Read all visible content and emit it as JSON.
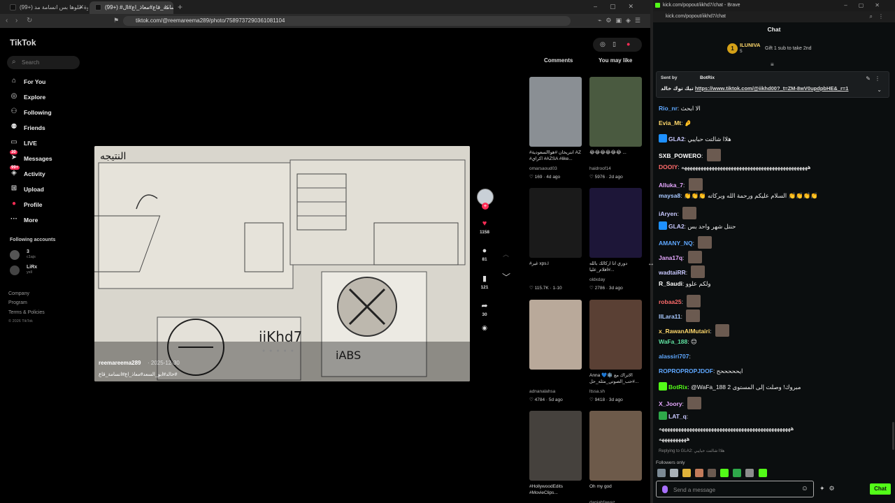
{
  "left_window": {
    "tabs": [
      {
        "label": "(99+) يالله انها حلوة حلوها بس انسامة مد...",
        "active": false
      },
      {
        "label": "(99+) #انسامة_قاع#معاذ_اع#ال...",
        "active": true
      }
    ],
    "url": "tiktok.com/@reemareema289/photo/7589737290361081104"
  },
  "tiktok": {
    "logo": "TikTok",
    "search_placeholder": "Search",
    "nav": [
      {
        "label": "For You",
        "icon": "home-icon"
      },
      {
        "label": "Explore",
        "icon": "compass-icon"
      },
      {
        "label": "Following",
        "icon": "following-icon"
      },
      {
        "label": "Friends",
        "icon": "friends-icon"
      },
      {
        "label": "LIVE",
        "icon": "live-icon"
      },
      {
        "label": "Messages",
        "icon": "messages-icon",
        "badge": "30"
      },
      {
        "label": "Activity",
        "icon": "activity-icon",
        "badge": "99+"
      },
      {
        "label": "Upload",
        "icon": "upload-icon"
      },
      {
        "label": "Profile",
        "icon": "profile-icon"
      },
      {
        "label": "More",
        "icon": "more-icon"
      }
    ],
    "following_title": "Following accounts",
    "accounts": [
      {
        "name": "3",
        "sub": "c1ajs"
      },
      {
        "name": "LiRx",
        "sub": "yxll"
      }
    ],
    "footer": [
      "Company",
      "Program",
      "Terms & Policies"
    ],
    "copyright": "© 2026 TikTok",
    "post": {
      "title": "النتيجه",
      "username": "reemareema289",
      "date": "· 2025-12-30",
      "tags": "خالد#ابو_السعد#معاذ_اع#انسامة_قاع#"
    },
    "actions": {
      "likes": "1158",
      "comments": "81",
      "saves": "121",
      "shares": "30"
    },
    "side_tabs": {
      "comments": "Comments",
      "you_may_like": "You may like"
    },
    "grid": [
      {
        "caption": "#انتريخان #هواالسعودية AZ #اكراي #AZSA #like...",
        "user": "omarsaoud03",
        "likes": "169",
        "age": "4d ago",
        "color": "#8a8f94"
      },
      {
        "caption": "😂😂😂😂😂😂 ...",
        "user": "haidroof14",
        "likes": "5976",
        "age": "2d ago",
        "color": "#4a5a40"
      },
      {
        "caption": "#غير xps.l",
        "user": "",
        "likes": "115.7K",
        "age": "1-10",
        "color": "#1a1a1a"
      },
      {
        "caption": "دوري انا اركالك بالله ...#افلام_عليا",
        "user": "oldxday",
        "likes": "2786",
        "age": "3d ago",
        "color": "#1d1638"
      },
      {
        "caption": "",
        "user": "adnanalahsa",
        "likes": "4784",
        "age": "5d ago",
        "color": "#b9a99a"
      },
      {
        "caption": "Anna 💙❄️ الاتراك مع ...#حب_الصوتي_مثله_حل",
        "user": "ltssa.sh",
        "likes": "9418",
        "age": "3d ago",
        "color": "#5a4034"
      },
      {
        "caption": "#HollywoodEdits #MovieClips...",
        "user": "",
        "likes": "",
        "age": "",
        "color": "#45413d"
      },
      {
        "caption": "Oh my god",
        "user": "daniahfawaz",
        "likes": "",
        "age": "",
        "color": "#6d5a4a"
      }
    ]
  },
  "right_window": {
    "title": "kick.com/popout/iikhd7/chat - Brave",
    "url": "kick.com/popout/iikhd7/chat",
    "chat_title": "Chat",
    "gift": {
      "user": "ILUNIVA",
      "count": "5",
      "text": "Gift 1 sub to take 2nd"
    },
    "pinned": {
      "sent_by": "Sent by",
      "bot": "BotRix",
      "prefix": "تيك توك خالد",
      "link": "https://www.tiktok.com/@iikhd00?_t=ZM-8wV0updpbHE&_r=1"
    },
    "messages": [
      {
        "user": "Rio_nr",
        "text": "الا ابحث",
        "color": "#5fa8ff"
      },
      {
        "user": "Evia_Mt",
        "text": "🤌",
        "color": "#ffd86b"
      },
      {
        "user": "GLA2",
        "text": "هلاا شالتت حبايبي",
        "color": "#c9c9ff"
      },
      {
        "user": "SXB_POWERO",
        "text": "",
        "color": "#ffffff"
      },
      {
        "user": "DOOIY",
        "text": "ههههههههههههههههههههههههههههههههههههههههههههههه",
        "color": "#ff6b6b"
      },
      {
        "user": "Alluka_7",
        "text": "",
        "color": "#e6a8ff"
      },
      {
        "user": "maysa8",
        "text": "👏👏👏 السلام عليكم ورحمة الله وبركاته 👏👏👏👏",
        "color": "#a8c8ff"
      },
      {
        "user": "iAryen",
        "text": "",
        "color": "#c9c9ff"
      },
      {
        "user": "GLA2",
        "text": "حنتل شهر واحد بس",
        "color": "#c9c9ff"
      },
      {
        "user": "AMANY_NQ",
        "text": "",
        "color": "#5fa8ff"
      },
      {
        "user": "Jana17q",
        "text": "",
        "color": "#e6a8ff"
      },
      {
        "user": "wadtaiRR",
        "text": "",
        "color": "#c9c9ff"
      },
      {
        "user": "R_Saudi",
        "text": "ولكم علوو",
        "color": "#ffffff"
      },
      {
        "user": "robaa25",
        "text": "",
        "color": "#ff6b6b"
      },
      {
        "user": "lILara11",
        "text": "",
        "color": "#a8c8ff"
      },
      {
        "user": "x_RawanAlMutairi",
        "text": "",
        "color": "#ffd86b"
      },
      {
        "user": "WaFa_188",
        "text": "😊",
        "color": "#5fe0a0"
      },
      {
        "user": "alassiri707",
        "text": "",
        "color": "#5fa8ff"
      },
      {
        "user": "ROPROPROPJDOF",
        "text": "ايحححححح",
        "color": "#5fa8ff"
      },
      {
        "user": "BotRix",
        "text": "@WaFa_188 مبروك! وصلت إلى المستوى 2",
        "color": "#53fc18"
      },
      {
        "user": "X_Joory",
        "text": "",
        "color": "#e6a8ff"
      },
      {
        "user": "LAT_q",
        "text": "",
        "color": "#c9c9ff"
      }
    ],
    "long_laugh": "ههههههههههههههههههههههههههههههههههههههههههههههههه",
    "long_laugh2": "ههههههههههه",
    "reply_hint": "Replying to GLA2: هلاا شالتت حبايبي",
    "followers_only": "Followers only",
    "send_placeholder": "Send a message",
    "chat_button": "Chat"
  }
}
